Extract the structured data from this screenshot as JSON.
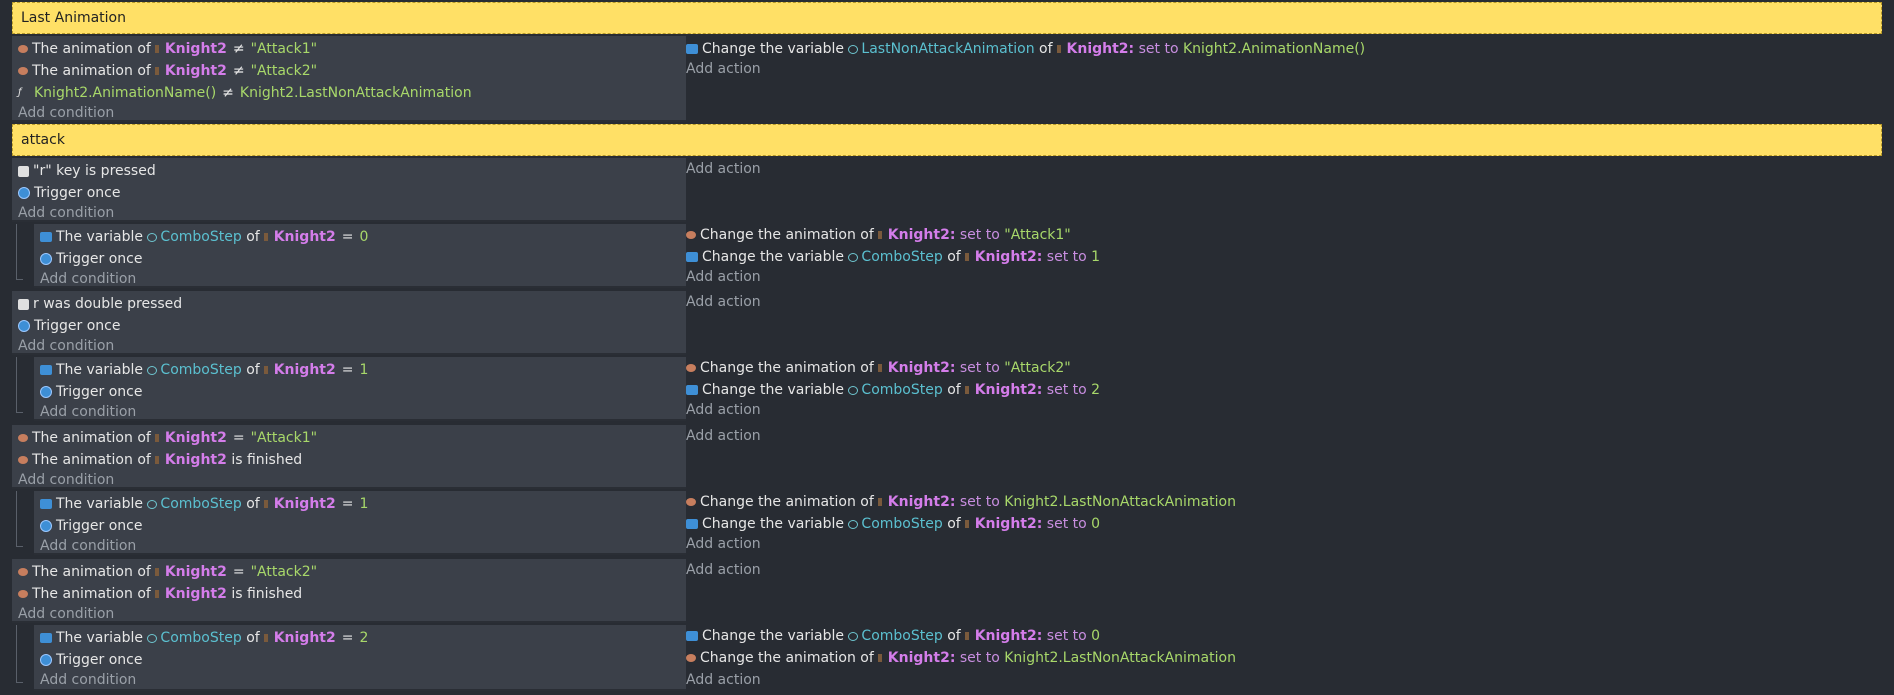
{
  "groups": {
    "last_animation": "Last Animation",
    "attack": "attack"
  },
  "labels": {
    "add_condition": "Add condition",
    "add_action": "Add action",
    "the_animation_of": "The animation of",
    "the_variable": "The variable",
    "of": "of",
    "trigger_once": "Trigger once",
    "change_the_variable": "Change the variable",
    "change_the_animation_of": "Change the animation of",
    "set_to": "set to",
    "is_finished": "is finished",
    "key_is_pressed": "\"r\"  key is pressed",
    "double_pressed": "r was double pressed"
  },
  "objects": {
    "knight": "Knight2",
    "knight_colon": "Knight2:"
  },
  "vars": {
    "last_non_attack": "LastNonAttackAnimation",
    "combo_step": "ComboStep"
  },
  "values": {
    "attack1": "\"Attack1\"",
    "attack2": "\"Attack2\"",
    "anim_name_expr": "Knight2.AnimationName()",
    "last_non_attack_expr": "Knight2.LastNonAttackAnimation",
    "zero": "0",
    "one": "1",
    "two": "2"
  },
  "ops": {
    "neq": "≠",
    "eq": "="
  }
}
